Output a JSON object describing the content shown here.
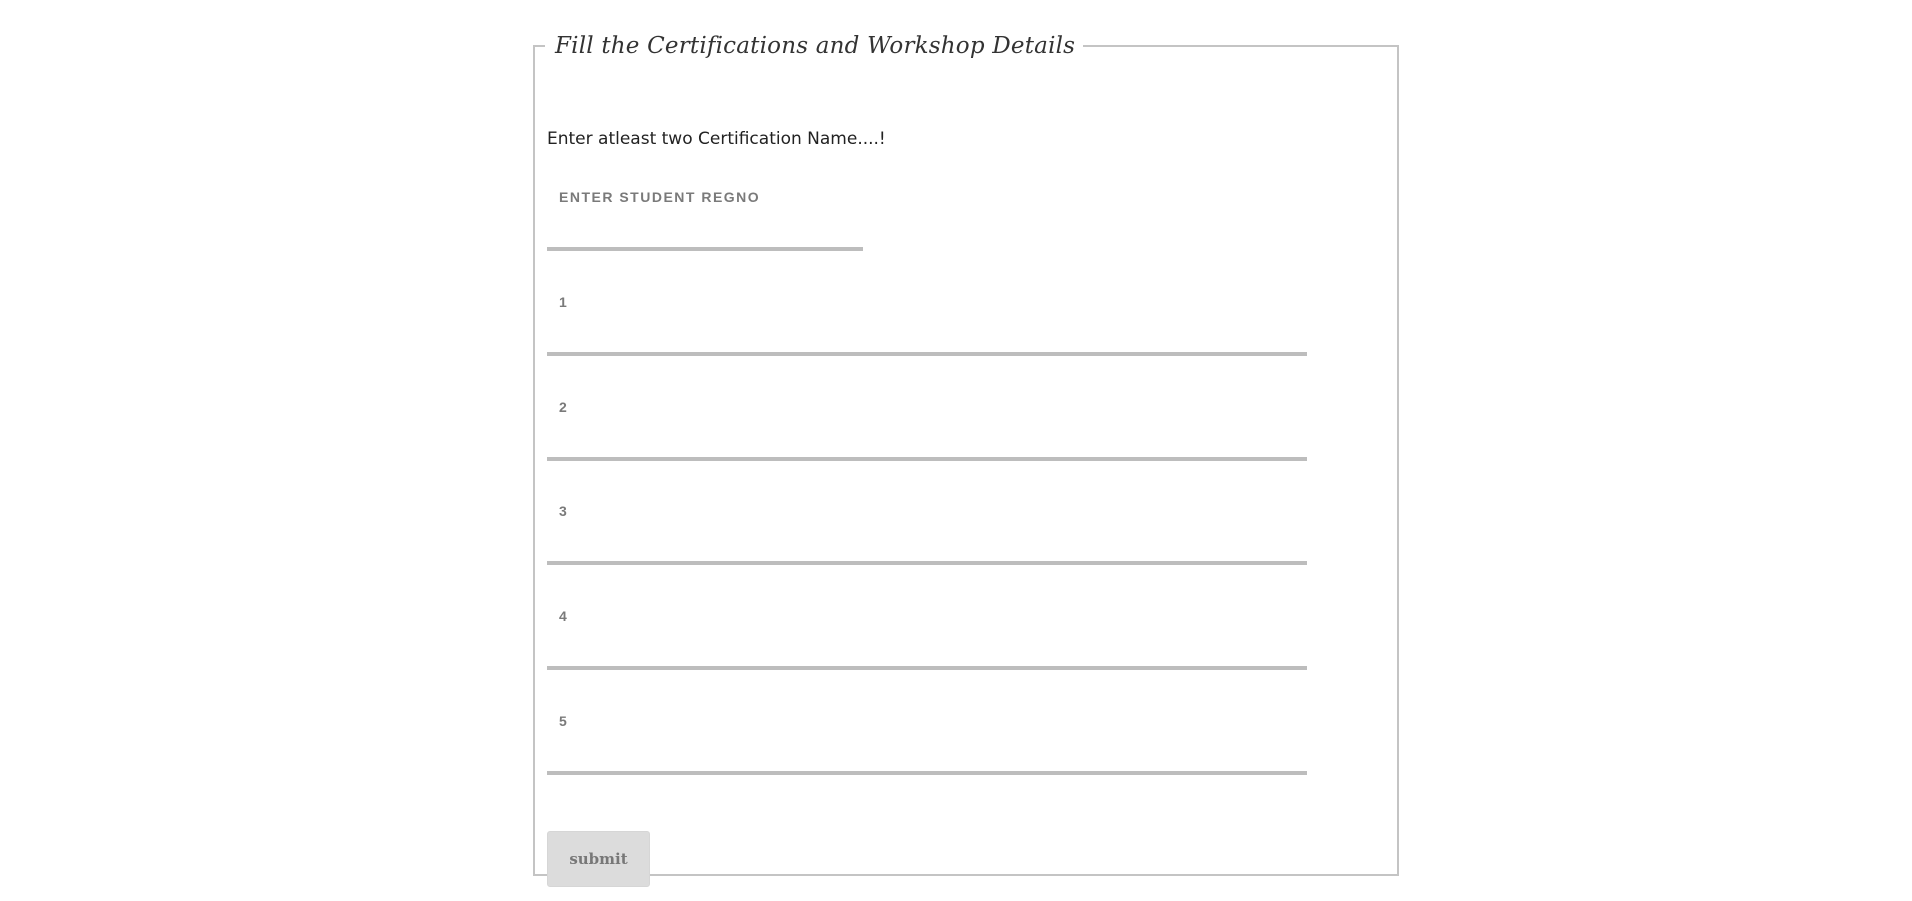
{
  "form": {
    "legend": "Fill the Certifications and Workshop Details",
    "instruction": "Enter atleast two Certification Name....!",
    "regno": {
      "label": "ENTER STUDENT REGNO",
      "value": ""
    },
    "certifications": [
      {
        "label": "1",
        "value": ""
      },
      {
        "label": "2",
        "value": ""
      },
      {
        "label": "3",
        "value": ""
      },
      {
        "label": "4",
        "value": ""
      },
      {
        "label": "5",
        "value": ""
      }
    ],
    "submit_label": "submit"
  },
  "colors": {
    "border": "#c4c4c4",
    "underline": "#bdbdbd",
    "label": "#7a7a7a",
    "button_bg": "#dcdcdc"
  }
}
